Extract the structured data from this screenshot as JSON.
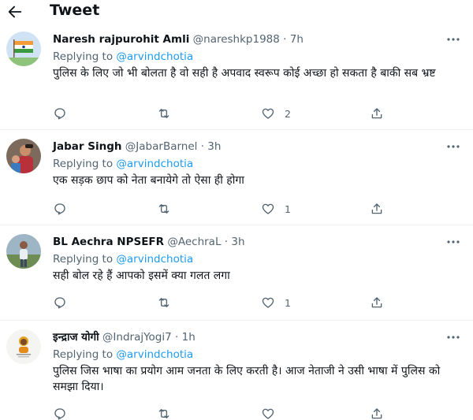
{
  "header": {
    "title": "Tweet",
    "back_icon": "arrow-left-icon"
  },
  "colors": {
    "accent": "#1d9bf0",
    "secondary_text": "#536471",
    "primary_text": "#0f1419",
    "divider": "#eff3f4"
  },
  "tweets": [
    {
      "name": "Naresh rajpurohit Amli",
      "handle": "@nareshkp1988",
      "separator": "·",
      "time": "7h",
      "replying_prefix": "Replying to",
      "replying_to": "@arvindchotia",
      "text": "पुलिस के लिए जो भी बोलता है वो सही है अपवाद स्वरूप कोई अच्छा हो सकता है बाकी सब भ्रष्ट",
      "counts": {
        "replies": "",
        "retweets": "",
        "likes": "2"
      }
    },
    {
      "name": "Jabar Singh",
      "handle": "@JabarBarnel",
      "separator": "·",
      "time": "3h",
      "replying_prefix": "Replying to",
      "replying_to": "@arvindchotia",
      "text": "एक सड़क छाप को नेता बनायेगे तो ऐसा ही होगा",
      "counts": {
        "replies": "",
        "retweets": "",
        "likes": "1"
      }
    },
    {
      "name": "BL Aechra NPSEFR",
      "handle": "@AechraL",
      "separator": "·",
      "time": "3h",
      "replying_prefix": "Replying to",
      "replying_to": "@arvindchotia",
      "text": "सही बोल रहे हैं आपको इसमें क्या गलत लगा",
      "counts": {
        "replies": "",
        "retweets": "",
        "likes": "1"
      }
    },
    {
      "name": "इन्द्राज योगी",
      "handle": "@IndrajYogi7",
      "separator": "·",
      "time": "1h",
      "replying_prefix": "Replying to",
      "replying_to": "@arvindchotia",
      "text": "पुलिस जिस भाषा का प्रयोग आम जनता के लिए करती है। आज नेताजी ने उसी भाषा में पुलिस को समझा दिया।",
      "counts": {
        "replies": "",
        "retweets": "",
        "likes": ""
      }
    }
  ]
}
